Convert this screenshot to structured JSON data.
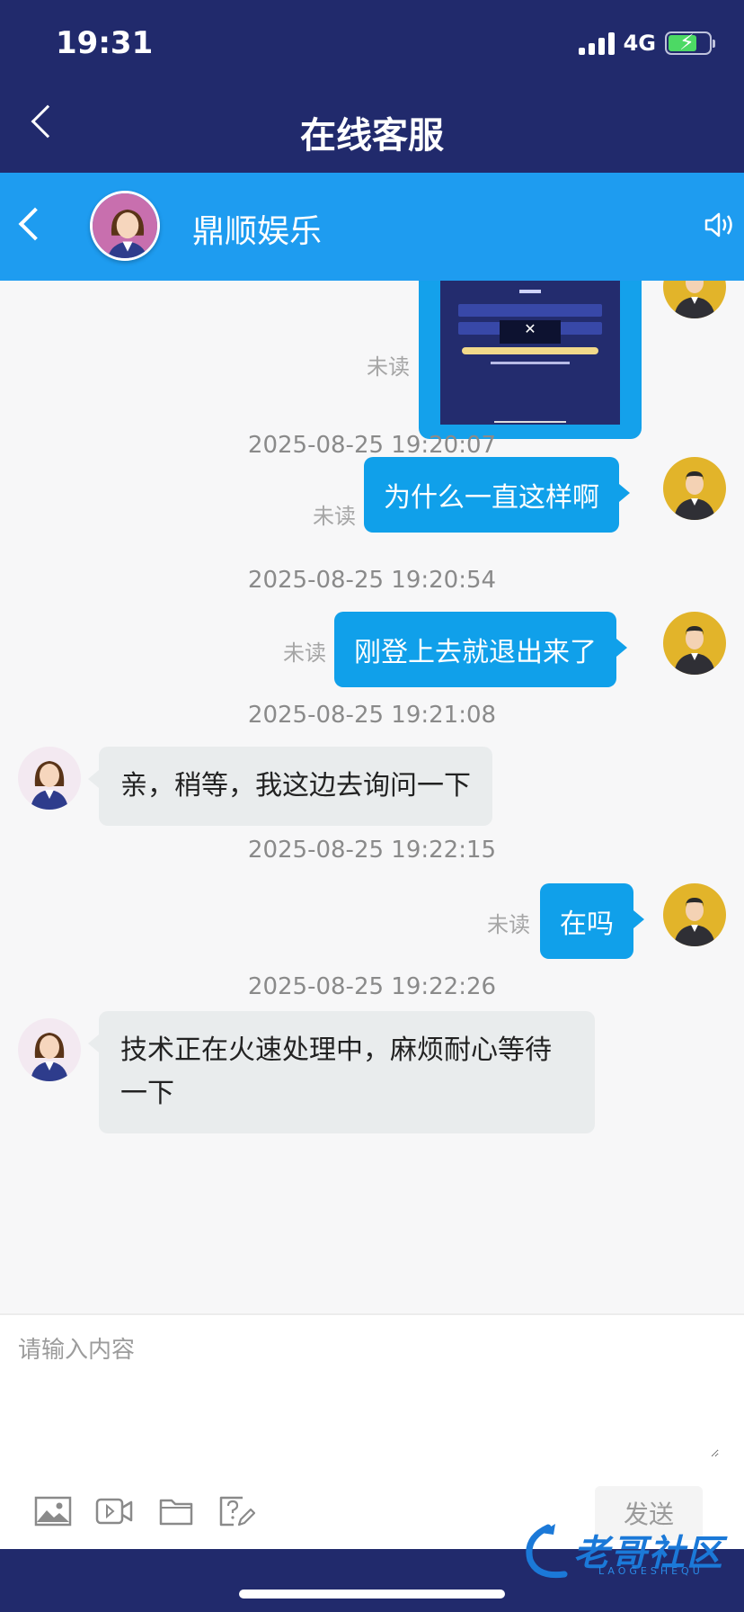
{
  "status_bar": {
    "time": "19:31",
    "network": "4G"
  },
  "nav": {
    "title": "在线客服"
  },
  "chat_header": {
    "name": "鼎顺娱乐"
  },
  "messages": [
    {
      "type": "image",
      "direction": "out",
      "status": "未读"
    },
    {
      "timestamp": "2025-08-25 19:20:07",
      "direction": "out",
      "text": "为什么一直这样啊",
      "status": "未读"
    },
    {
      "timestamp": "2025-08-25 19:20:54",
      "direction": "out",
      "text": "刚登上去就退出来了",
      "status": "未读"
    },
    {
      "timestamp": "2025-08-25 19:21:08",
      "direction": "in",
      "text": "亲，稍等，我这边去询问一下"
    },
    {
      "timestamp": "2025-08-25 19:22:15",
      "direction": "out",
      "text": "在吗",
      "status": "未读"
    },
    {
      "timestamp": "2025-08-25 19:22:26",
      "direction": "in",
      "text": "技术正在火速处理中，麻烦耐心等待一下"
    }
  ],
  "input": {
    "placeholder": "请输入内容",
    "send_label": "发送"
  },
  "toolbar_icons": [
    "image-icon",
    "video-icon",
    "folder-icon",
    "question-edit-icon"
  ],
  "watermark": {
    "text": "老哥社区",
    "sub": "LAOGESHEQU"
  },
  "colors": {
    "nav_bg": "#212a6c",
    "header_bg": "#1e9cf0",
    "bubble_out": "#10a0ea",
    "bubble_in": "#e9eced"
  }
}
